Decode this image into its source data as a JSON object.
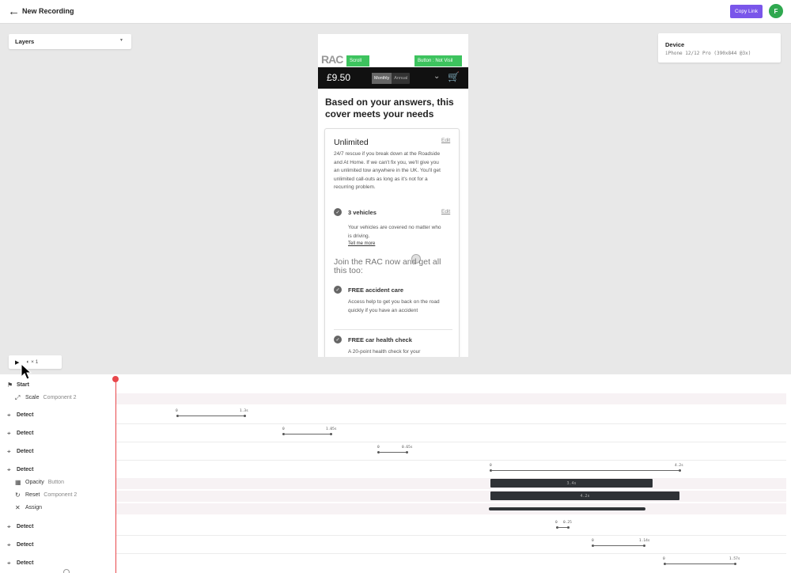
{
  "header": {
    "title": "New Recording",
    "copy_label": "Copy Link",
    "avatar_initial": "F"
  },
  "layers": {
    "label": "Layers"
  },
  "device": {
    "label": "Device",
    "value": "iPhone 12/12 Pro (390x844 @3x)"
  },
  "phone": {
    "logo": "RAC",
    "tag_scroll": "Scroll",
    "tag_button": "Button : Not Visil",
    "price": "£9.50",
    "toggle_monthly": "Monthly",
    "toggle_annual": "Annual",
    "heading": "Based on your answers, this cover meets your needs",
    "card_title": "Unlimited",
    "edit": "Edit",
    "card_desc": "24/7 rescue if you break down at the Roadside and At Home. If we can't fix you, we'll give you an unlimited tow anywhere in the UK. You'll get unlimited call-outs as long as it's not for a recurring problem.",
    "vehicles_title": "3 vehicles",
    "vehicles_desc": "Your vehicles are covered no matter who is driving.",
    "tell_more": "Tell me more",
    "join": "Join the RAC now and get all this too:",
    "accident_title": "FREE accident care",
    "accident_desc": "Access help to get you back on the road quickly if you have an accident",
    "health_title": "FREE car health check",
    "health_desc": "A 20-point health check for your"
  },
  "playback": {
    "speed": "× 1"
  },
  "timeline": {
    "start": "Start",
    "scale": "Scale",
    "scale_target": "Component 2",
    "detect": "Detect",
    "opacity": "Opacity",
    "opacity_target": "Button",
    "reset": "Reset",
    "reset_target": "Component 2",
    "assign": "Assign",
    "seg_labels": {
      "zero": "0",
      "d1": "1.3s",
      "d2": "1.05s",
      "d3": "0.65s",
      "d4": "4.2s",
      "bar1": "3.4s",
      "bar2": "4.2s",
      "d5": "0.25",
      "d6": "1.14s",
      "d7": "1.57s"
    }
  }
}
